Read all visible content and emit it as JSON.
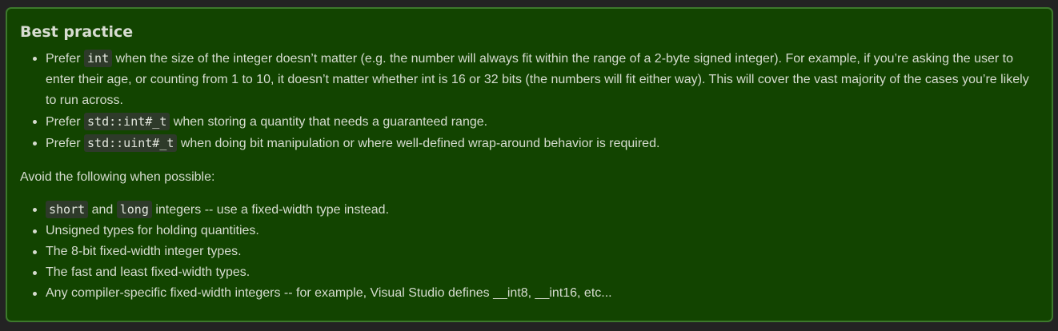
{
  "callout": {
    "title": "Best practice",
    "practices": [
      {
        "pre": "Prefer ",
        "code": "int",
        "post": " when the size of the integer doesn’t matter (e.g. the number will always fit within the range of a 2-byte signed integer). For example, if you’re asking the user to enter their age, or counting from 1 to 10, it doesn’t matter whether int is 16 or 32 bits (the numbers will fit either way). This will cover the vast majority of the cases you’re likely to run across."
      },
      {
        "pre": "Prefer ",
        "code": "std::int#_t",
        "post": " when storing a quantity that needs a guaranteed range."
      },
      {
        "pre": "Prefer ",
        "code": "std::uint#_t",
        "post": " when doing bit manipulation or where well-defined wrap-around behavior is required."
      }
    ],
    "avoid_intro": "Avoid the following when possible:",
    "avoid_first": {
      "code1": "short",
      "mid": " and ",
      "code2": "long",
      "post": " integers -- use a fixed-width type instead."
    },
    "avoid_items": [
      "Unsigned types for holding quantities.",
      "The 8-bit fixed-width integer types.",
      "The fast and least fixed-width types.",
      "Any compiler-specific fixed-width integers -- for example, Visual Studio defines __int8, __int16, etc..."
    ]
  },
  "colors": {
    "page_background": "#232323",
    "callout_background": "#124400",
    "callout_border": "#3d7a2c",
    "text": "#d6dccf",
    "code_background": "#2e3a2a"
  }
}
